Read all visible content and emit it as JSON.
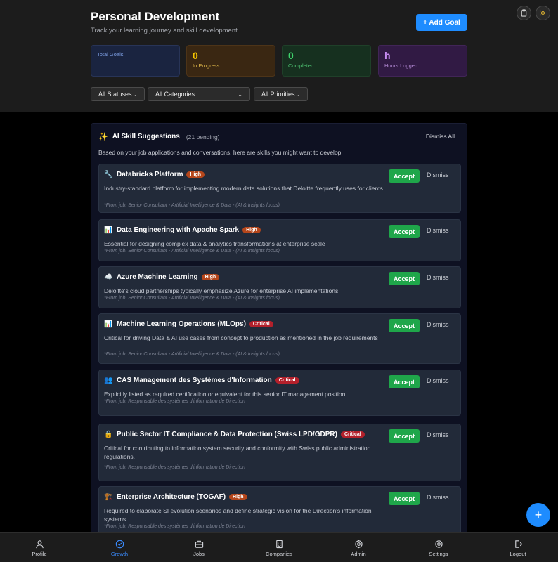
{
  "header": {
    "title": "Personal Development",
    "subtitle": "Track your learning journey and skill development",
    "add_goal_label": "+ Add Goal"
  },
  "stats": {
    "total": {
      "label": "Total Goals",
      "value": ""
    },
    "in_progress": {
      "label": "In Progress",
      "value": "0"
    },
    "completed": {
      "label": "Completed",
      "value": "0"
    },
    "hours": {
      "label": "Hours Logged",
      "value": "h"
    }
  },
  "filters": {
    "status": "All Statuses",
    "category": "All Categories",
    "priority": "All Priorities"
  },
  "suggestions": {
    "title": "AI Skill Suggestions",
    "count": "(21 pending)",
    "dismiss_all": "Dismiss All",
    "description": "Based on your job applications and conversations, here are skills you might want to develop:",
    "accept_label": "Accept",
    "dismiss_label": "Dismiss",
    "items": [
      {
        "icon": "🔧",
        "name": "Databricks Platform",
        "priority": "High",
        "desc": "Industry-standard platform for implementing modern data solutions that Deloitte frequently uses for clients",
        "source": "*From job: Senior Consultant - Artificial Intelligence & Data - (AI & Insights focus)"
      },
      {
        "icon": "📊",
        "name": "Data Engineering with Apache Spark",
        "priority": "High",
        "desc": "Essential for designing complex data & analytics transformations at enterprise scale",
        "source": "*From job: Senior Consultant - Artificial Intelligence & Data - (AI & Insights focus)"
      },
      {
        "icon": "☁️",
        "name": "Azure Machine Learning",
        "priority": "High",
        "desc": "Deloitte's cloud partnerships typically emphasize Azure for enterprise AI implementations",
        "source": "*From job: Senior Consultant - Artificial Intelligence & Data - (AI & Insights focus)"
      },
      {
        "icon": "📊",
        "name": "Machine Learning Operations (MLOps)",
        "priority": "Critical",
        "desc": "Critical for driving Data & AI use cases from concept to production as mentioned in the job requirements",
        "source": "*From job: Senior Consultant - Artificial Intelligence & Data - (AI & Insights focus)"
      },
      {
        "icon": "👥",
        "name": "CAS Management des Systèmes d'Information",
        "priority": "Critical",
        "desc": "Explicitly listed as required certification or equivalent for this senior IT management position.",
        "source": "*From job: Responsable des systèmes d'information de Direction"
      },
      {
        "icon": "🔒",
        "name": "Public Sector IT Compliance & Data Protection (Swiss LPD/GDPR)",
        "priority": "Critical",
        "desc": "Critical for contributing to information system security and conformity with Swiss public administration regulations.",
        "source": "*From job: Responsable des systèmes d'information de Direction"
      },
      {
        "icon": "🏗️",
        "name": "Enterprise Architecture (TOGAF)",
        "priority": "High",
        "desc": "Required to elaborate SI evolution scenarios and define strategic vision for the Direction's information systems.",
        "source": "*From job: Responsable des systèmes d'information de Direction"
      }
    ]
  },
  "fab_label": "+",
  "nav": [
    {
      "label": "Profile",
      "icon": "user-icon"
    },
    {
      "label": "Growth",
      "icon": "target-icon"
    },
    {
      "label": "Jobs",
      "icon": "briefcase-icon"
    },
    {
      "label": "Companies",
      "icon": "building-icon"
    },
    {
      "label": "Admin",
      "icon": "gear-icon"
    },
    {
      "label": "Settings",
      "icon": "gear-icon"
    },
    {
      "label": "Logout",
      "icon": "logout-icon"
    }
  ],
  "colors": {
    "accent": "#1e8cff",
    "accept": "#1fa64a",
    "high": "#b5461b",
    "critical": "#b3202b"
  }
}
